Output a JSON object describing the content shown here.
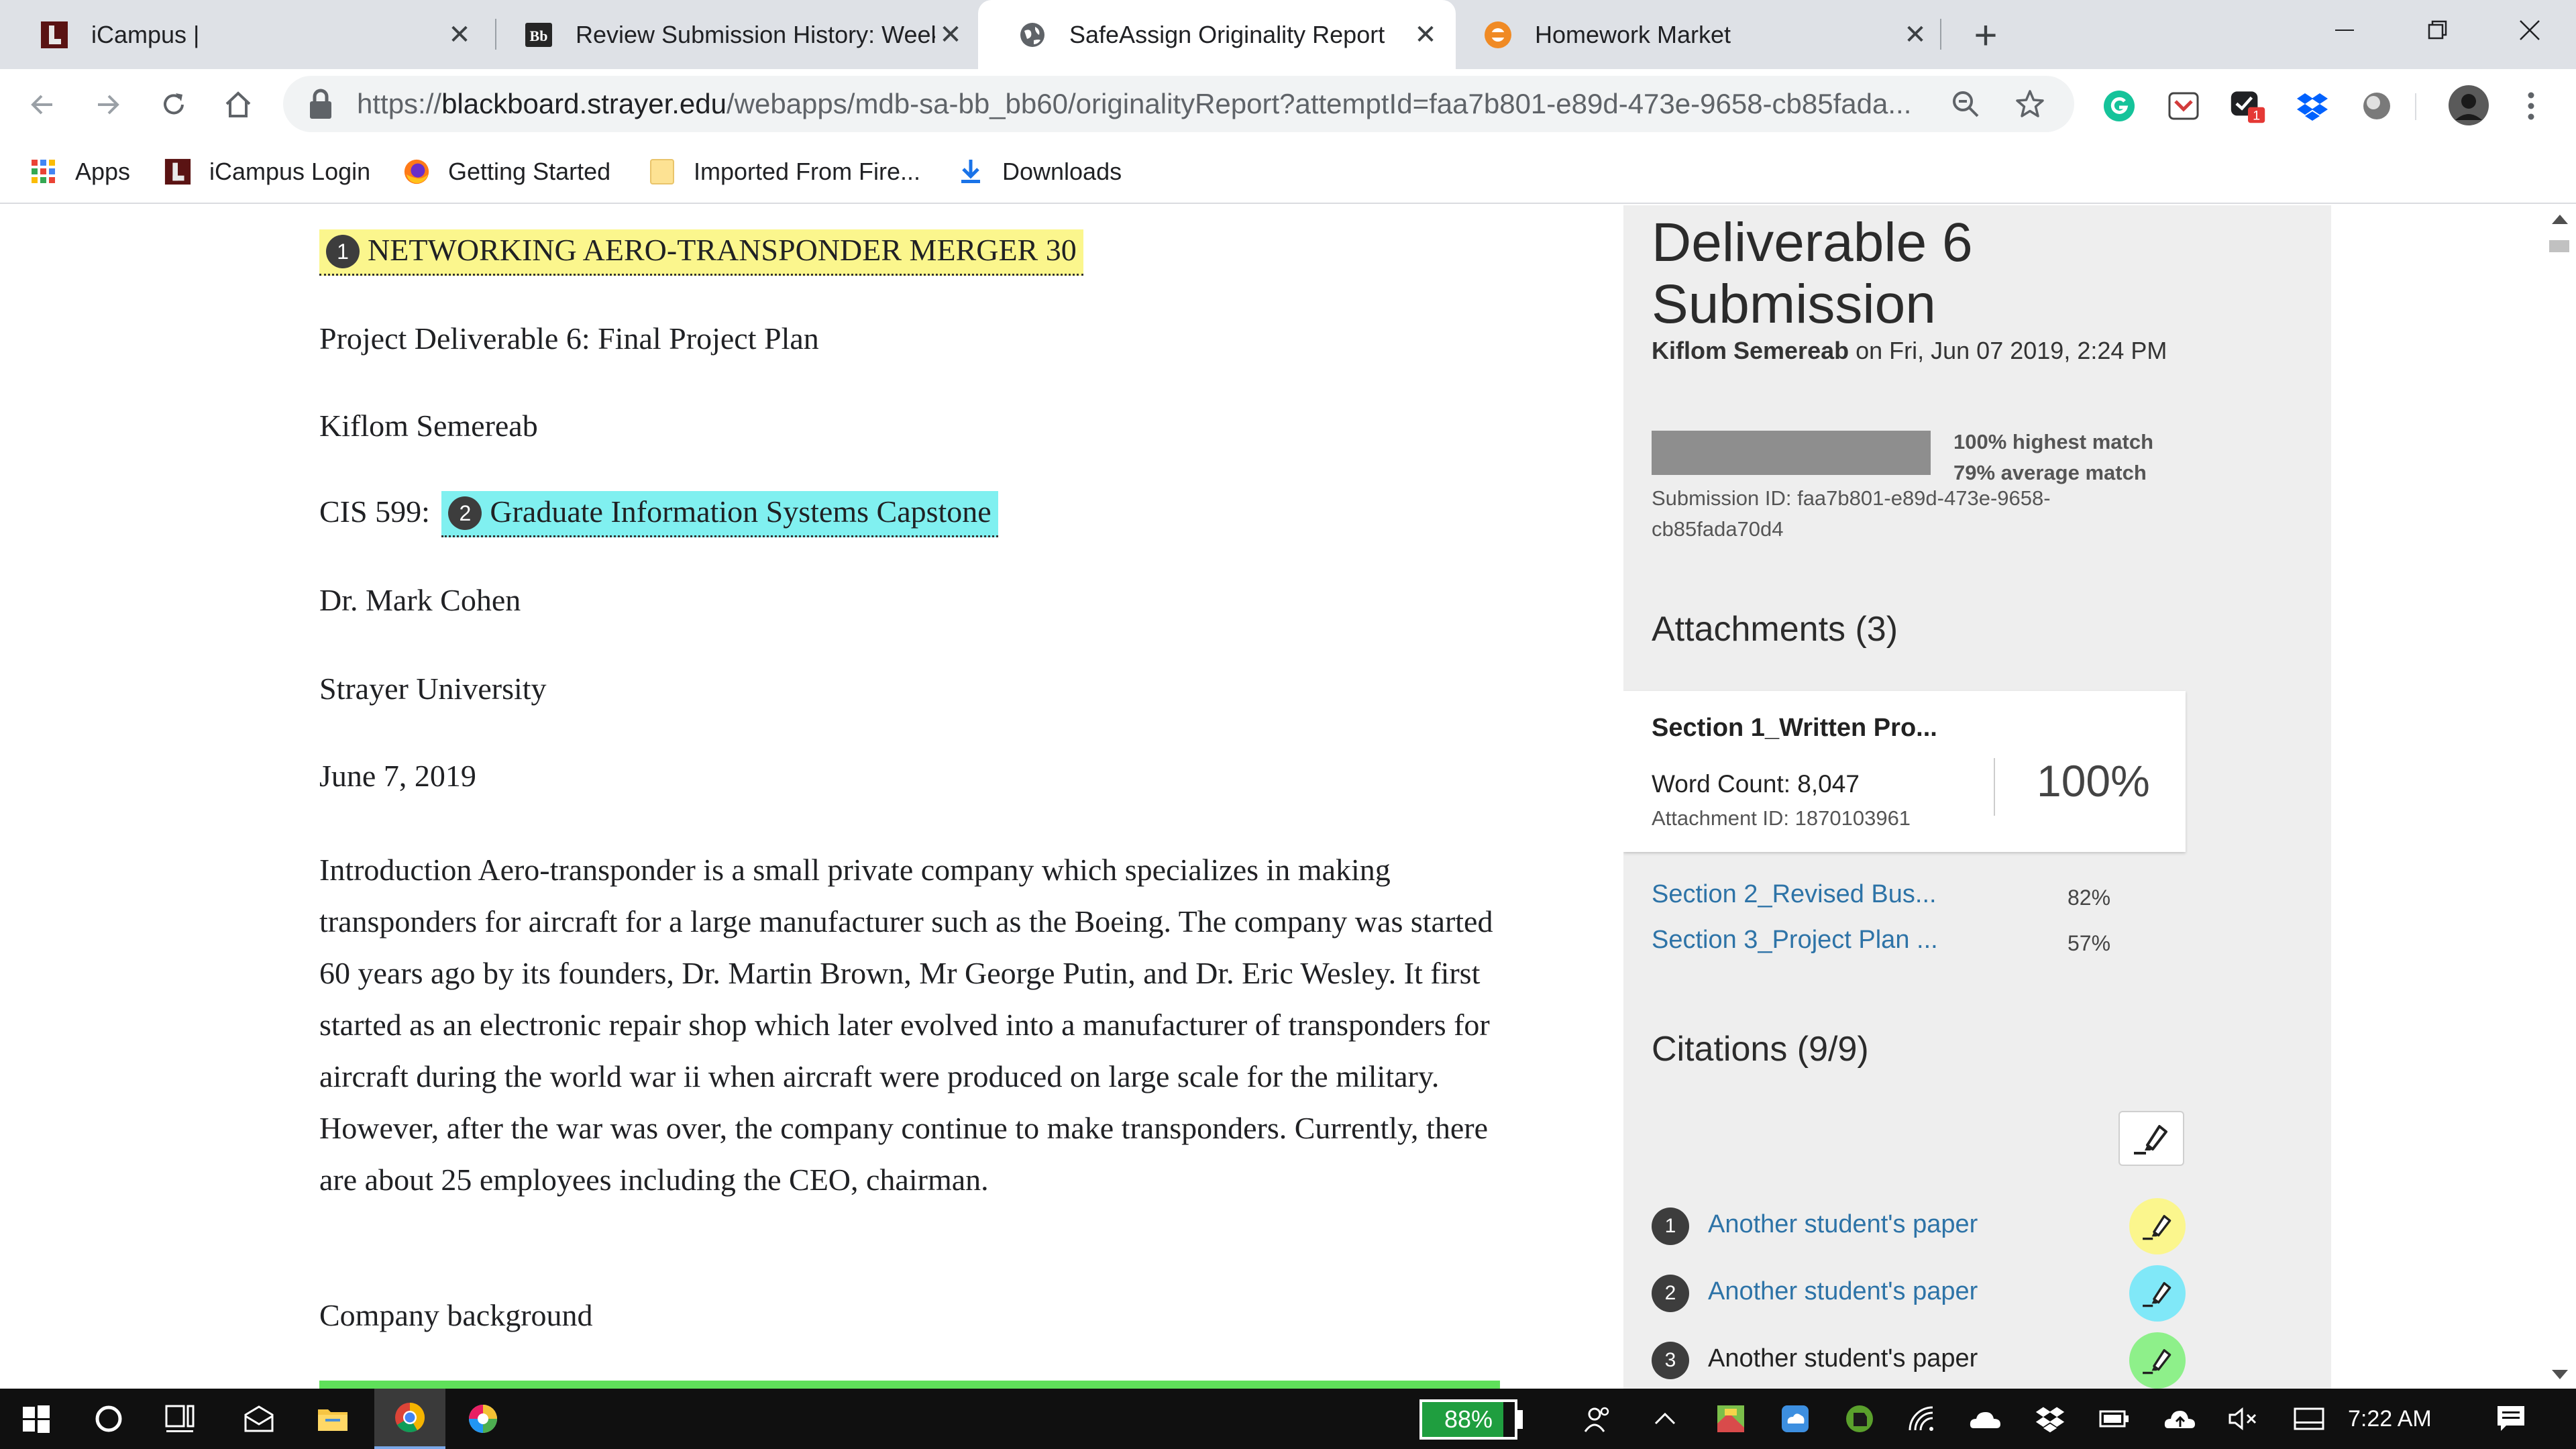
{
  "browser": {
    "tabs": [
      {
        "title": "iCampus |",
        "icon": "icampus-logo-icon",
        "active": false
      },
      {
        "title": "Review Submission History: Week",
        "icon": "blackboard-logo-icon",
        "active": false
      },
      {
        "title": "SafeAssign Originality Report",
        "icon": "globe-icon",
        "active": true
      },
      {
        "title": "Homework Market",
        "icon": "homework-market-icon",
        "active": false
      }
    ],
    "url_scheme": "https://",
    "url_host": "blackboard.strayer.edu",
    "url_path": "/webapps/mdb-sa-bb_bb60/originalityReport?attemptId=faa7b801-e89d-473e-9658-cb85fada...",
    "extension_badge": "1",
    "bookmarks": [
      {
        "label": "Apps",
        "icon": "apps-grid-icon"
      },
      {
        "label": "iCampus Login",
        "icon": "icampus-logo-icon"
      },
      {
        "label": "Getting Started",
        "icon": "firefox-icon"
      },
      {
        "label": "Imported From Fire...",
        "icon": "folder-icon"
      },
      {
        "label": "Downloads",
        "icon": "download-icon"
      }
    ]
  },
  "document": {
    "title_badge": "1",
    "title": "NETWORKING AERO-TRANSPONDER MERGER 30",
    "subtitle": "Project Deliverable 6: Final Project Plan",
    "author": "Kiflom Semereab",
    "course_prefix": "CIS 599:",
    "course_badge": "2",
    "course_name": "Graduate Information Systems Capstone",
    "instructor": "Dr. Mark Cohen",
    "university": "Strayer University",
    "date": "June 7, 2019",
    "intro": "Introduction Aero-transponder is a small private company which specializes in making transponders for aircraft for a large manufacturer such as the Boeing. The company was started 60 years ago by its founders, Dr. Martin Brown, Mr George Putin, and Dr. Eric Wesley. It first started as an electronic repair shop which later evolved into a manufacturer of transponders for aircraft during the world war ii when aircraft were produced on large scale for the military. However, after the war was over, the company continue to make transponders. Currently, there are about 25 employees including the CEO, chairman.",
    "section_heading": "Company background"
  },
  "report": {
    "title_line1": "Deliverable 6",
    "title_line2": "Submission",
    "author": "Kiflom Semereab",
    "submitted_on": " on Fri, Jun 07 2019, 2:24 PM",
    "highest_match": "100% highest match",
    "average_match": "79% average match",
    "submission_id": "Submission ID: faa7b801-e89d-473e-9658-cb85fada70d4",
    "attachments_heading": "Attachments (3)",
    "selected_attachment": {
      "name": "Section 1_Written Pro...",
      "word_count": "Word Count: 8,047",
      "attachment_id": "Attachment ID: 1870103961",
      "percent": "100%"
    },
    "other_attachments": [
      {
        "name": "Section 2_Revised Bus...",
        "percent": "82%"
      },
      {
        "name": "Section 3_Project Plan ...",
        "percent": "57%"
      }
    ],
    "citations_heading": "Citations (9/9)",
    "citations": [
      {
        "number": "1",
        "label": "Another student's paper",
        "highlight": "#fbf68d",
        "linked": true
      },
      {
        "number": "2",
        "label": "Another student's paper",
        "highlight": "#80e8f8",
        "linked": true
      },
      {
        "number": "3",
        "label": "Another student's paper",
        "highlight": "#8ef08a",
        "linked": false
      }
    ]
  },
  "taskbar": {
    "battery_percent": "88%",
    "battery_level": 0.88,
    "clock": "7:22 AM"
  },
  "colors": {
    "highlight_yellow": "#fbf68d",
    "highlight_cyan": "#80f0f0",
    "link_blue": "#2d73a7",
    "panel_bg": "#eeeeee",
    "battery_green": "#1f9e3f"
  }
}
